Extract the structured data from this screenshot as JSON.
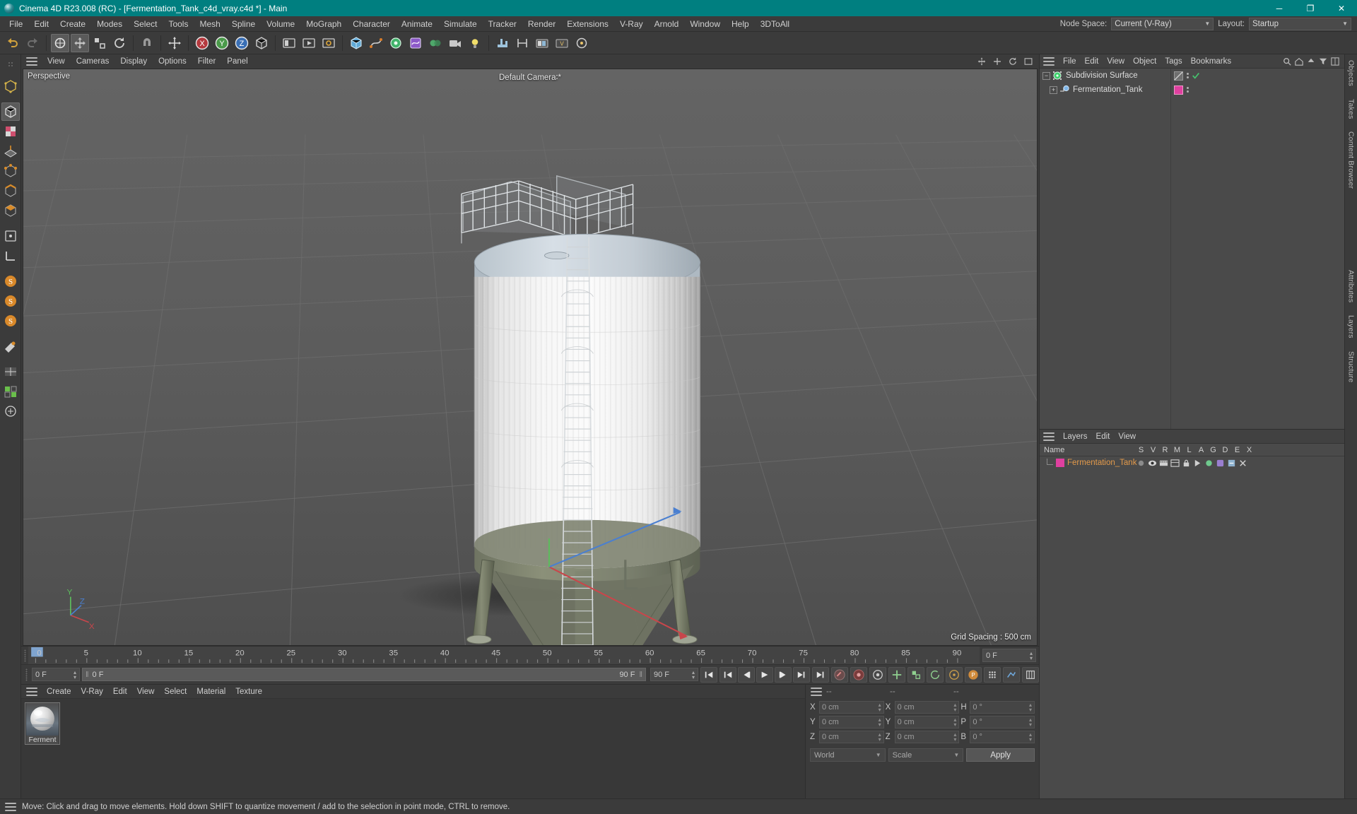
{
  "window": {
    "title": "Cinema 4D R23.008 (RC) - [Fermentation_Tank_c4d_vray.c4d *] - Main",
    "minimize": "─",
    "maximize": "❐",
    "close": "✕"
  },
  "menubar": {
    "items": [
      {
        "label": "File"
      },
      {
        "label": "Edit"
      },
      {
        "label": "Create"
      },
      {
        "label": "Modes"
      },
      {
        "label": "Select"
      },
      {
        "label": "Tools"
      },
      {
        "label": "Mesh"
      },
      {
        "label": "Spline"
      },
      {
        "label": "Volume"
      },
      {
        "label": "MoGraph"
      },
      {
        "label": "Character"
      },
      {
        "label": "Animate"
      },
      {
        "label": "Simulate"
      },
      {
        "label": "Tracker"
      },
      {
        "label": "Render"
      },
      {
        "label": "Extensions"
      },
      {
        "label": "V-Ray"
      },
      {
        "label": "Arnold"
      },
      {
        "label": "Window"
      },
      {
        "label": "Help"
      },
      {
        "label": "3DToAll"
      }
    ],
    "node_space_label": "Node Space:",
    "node_space_value": "Current (V-Ray)",
    "layout_label": "Layout:",
    "layout_value": "Startup"
  },
  "viewport_menu": {
    "items": [
      {
        "label": "View"
      },
      {
        "label": "Cameras"
      },
      {
        "label": "Display"
      },
      {
        "label": "Options"
      },
      {
        "label": "Filter"
      },
      {
        "label": "Panel"
      }
    ]
  },
  "viewport": {
    "corner_label": "Perspective",
    "camera_label": "Default Camera∶*",
    "grid_spacing": "Grid Spacing : 500 cm",
    "axis_x": "X",
    "axis_y": "Y",
    "axis_z": "Z"
  },
  "timeline": {
    "ticks": [
      "0",
      "5",
      "10",
      "15",
      "20",
      "25",
      "30",
      "35",
      "40",
      "45",
      "50",
      "55",
      "60",
      "65",
      "70",
      "75",
      "80",
      "85",
      "90"
    ],
    "start_frame": "0 F",
    "current_frame": "0 F",
    "scrub_value": "0 F",
    "end_frame_ruler": "0 F",
    "preview_end": "90 F",
    "end_frame": "90 F"
  },
  "material_manager": {
    "menu": [
      {
        "label": "Create"
      },
      {
        "label": "V-Ray"
      },
      {
        "label": "Edit"
      },
      {
        "label": "View"
      },
      {
        "label": "Select"
      },
      {
        "label": "Material"
      },
      {
        "label": "Texture"
      }
    ],
    "materials": [
      {
        "name": "Ferment"
      }
    ]
  },
  "coordinates": {
    "header": [
      "--",
      "--",
      "--"
    ],
    "position": {
      "x_label": "X",
      "x": "0 cm",
      "y_label": "Y",
      "y": "0 cm",
      "z_label": "Z",
      "z": "0 cm"
    },
    "size": {
      "x_label": "X",
      "x": "0 cm",
      "y_label": "Y",
      "y": "0 cm",
      "z_label": "Z",
      "z": "0 cm"
    },
    "rotation": {
      "h_label": "H",
      "h": "0 °",
      "p_label": "P",
      "p": "0 °",
      "b_label": "B",
      "b": "0 °"
    },
    "system": "World",
    "mode": "Scale",
    "apply": "Apply"
  },
  "object_manager": {
    "menu": [
      {
        "label": "File"
      },
      {
        "label": "Edit"
      },
      {
        "label": "View"
      },
      {
        "label": "Object"
      },
      {
        "label": "Tags"
      },
      {
        "label": "Bookmarks"
      }
    ],
    "objects": [
      {
        "label": "Subdivision Surface",
        "depth": 0,
        "icon": "subdivision-surface-icon",
        "swatch": "#7d7d7d",
        "check": true
      },
      {
        "label": "Fermentation_Tank",
        "depth": 1,
        "icon": "null-object-icon",
        "swatch": "#e040a0",
        "check": false
      }
    ]
  },
  "layer_manager": {
    "menu": [
      {
        "label": "Layers"
      },
      {
        "label": "Edit"
      },
      {
        "label": "View"
      }
    ],
    "columns": [
      "Name",
      "S",
      "V",
      "R",
      "M",
      "L",
      "A",
      "G",
      "D",
      "E",
      "X"
    ],
    "layers": [
      {
        "name": "Fermentation_Tank",
        "color": "#e040a0"
      }
    ]
  },
  "right_tabs": [
    "Objects",
    "Takes",
    "Content Browser"
  ],
  "right_tabs_lower": [
    "Attributes",
    "Layers",
    "Structure"
  ],
  "statusbar": {
    "message": "Move: Click and drag to move elements. Hold down SHIFT to quantize movement / add to the selection in point mode, CTRL to remove."
  },
  "colors": {
    "accent": "#007f80",
    "panel_bg": "#3b3b3b",
    "field_bg": "#4a4a4a",
    "layer_swatch": "#e040a0",
    "layer_text": "#e39a4a",
    "axis_x": "#c8464b",
    "axis_y": "#5dbb5d",
    "axis_z": "#4a7fd0"
  }
}
